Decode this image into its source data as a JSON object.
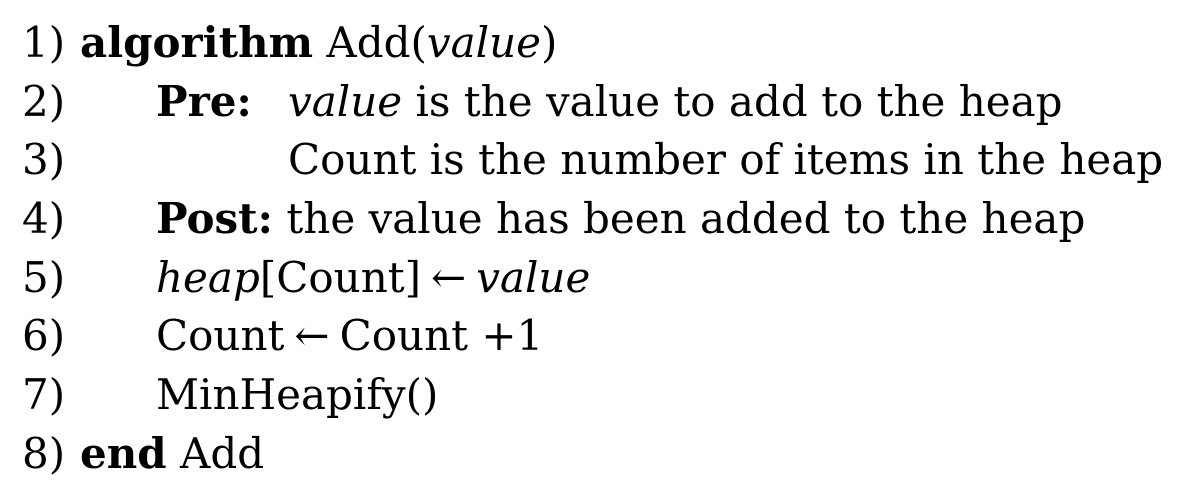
{
  "algorithm": {
    "lines": [
      {
        "num": "1)",
        "keyword": "algorithm",
        "name": "Add(",
        "param": "value",
        "close": ")"
      },
      {
        "num": "2)",
        "keyword": "Pre:",
        "param": "value",
        "text": "is the value to add to the heap"
      },
      {
        "num": "3)",
        "text": "Count is the number of items in the heap"
      },
      {
        "num": "4)",
        "keyword": "Post:",
        "text": "the value has been added to the heap"
      },
      {
        "num": "5)",
        "lhs_italic": "heap",
        "lhs_rest": "[Count]",
        "arrow": "←",
        "rhs_italic": "value"
      },
      {
        "num": "6)",
        "lhs": "Count",
        "arrow": "←",
        "rhs": "Count +1"
      },
      {
        "num": "7)",
        "text": "MinHeapify()"
      },
      {
        "num": "8)",
        "keyword": "end",
        "text": "Add"
      }
    ]
  }
}
